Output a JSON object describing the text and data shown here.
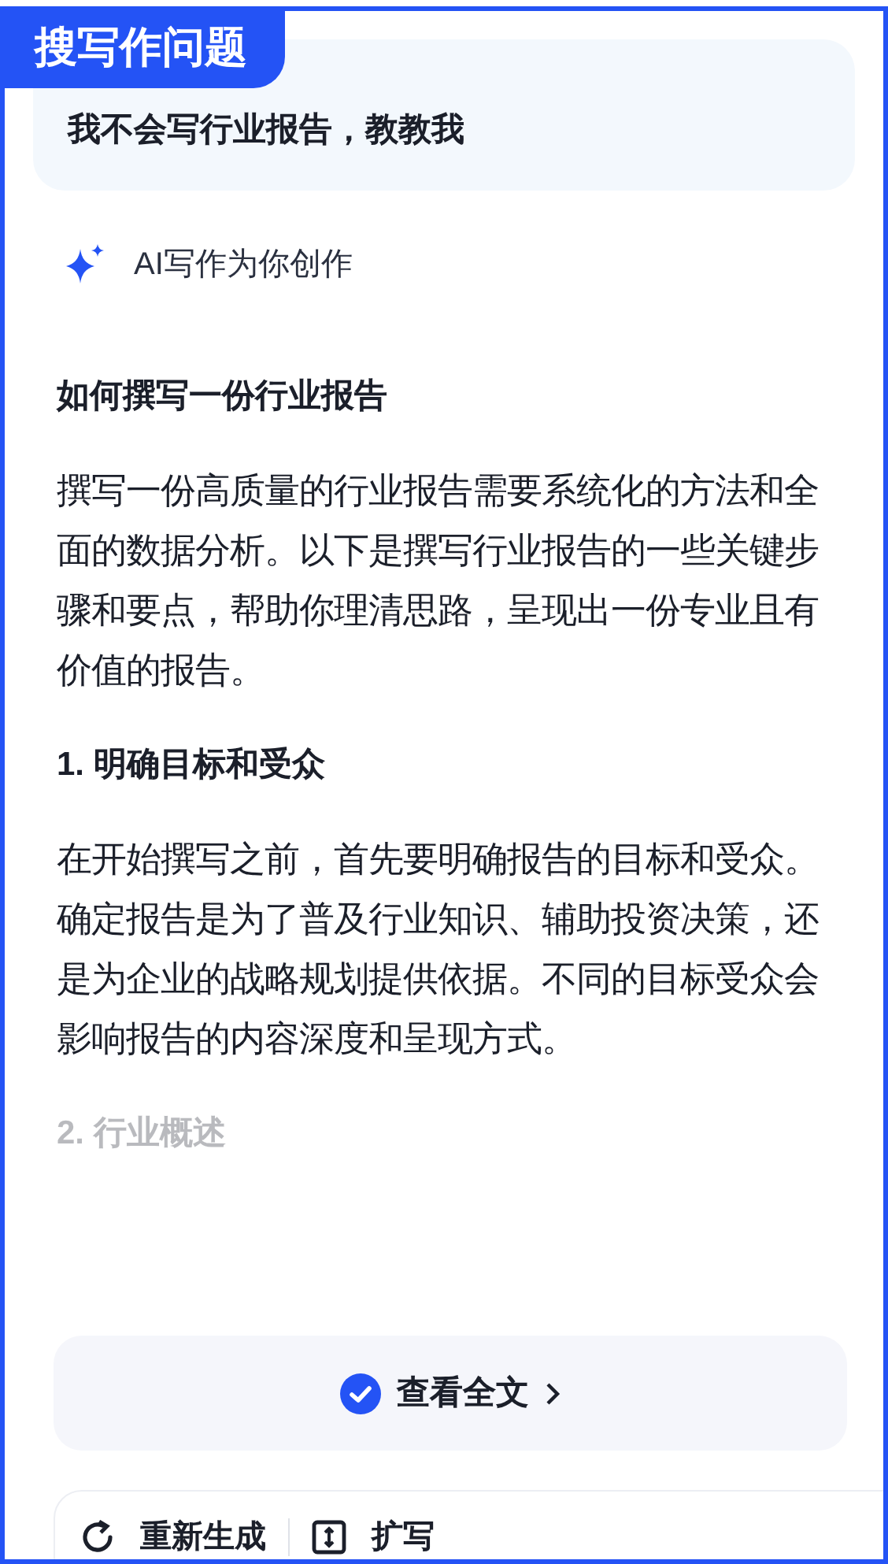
{
  "badge": "搜写作问题",
  "question": "我不会写行业报告，教教我",
  "ai_label": "AI写作为你创作",
  "article": [
    {
      "kind": "title",
      "text": "如何撰写一份行业报告",
      "faded": false
    },
    {
      "kind": "paragraph",
      "text": "撰写一份高质量的行业报告需要系统化的方法和全面的数据分析。以下是撰写行业报告的一些关键步骤和要点，帮助你理清思路，呈现出一份专业且有价值的报告。",
      "faded": false
    },
    {
      "kind": "heading",
      "text": "1. 明确目标和受众",
      "faded": false
    },
    {
      "kind": "paragraph",
      "text": "在开始撰写之前，首先要明确报告的目标和受众。确定报告是为了普及行业知识、辅助投资决策，还是为企业的战略规划提供依据。不同的目标受众会影响报告的内容深度和呈现方式。",
      "faded": false
    },
    {
      "kind": "heading",
      "text": "2. 行业概述",
      "faded": true
    }
  ],
  "read_more": "查看全文",
  "toolbar": [
    {
      "kind": "regenerate",
      "label": "重新生成"
    },
    {
      "kind": "expand",
      "label": "扩写"
    }
  ]
}
